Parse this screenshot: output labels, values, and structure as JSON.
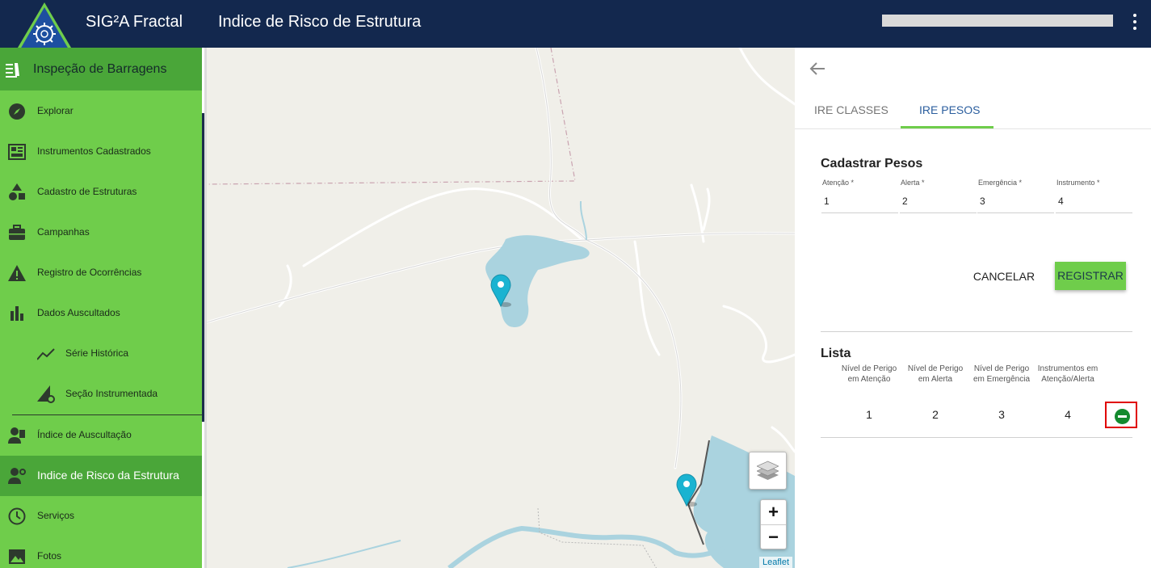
{
  "header": {
    "app_name": "SIG²A Fractal",
    "page_title": "Indice de Risco de Estrutura",
    "background_color": "#13284e"
  },
  "sidebar": {
    "section_title": "Inspeção de Barragens",
    "background_color": "#6fcd4b",
    "active_color": "#4aa639",
    "items": [
      {
        "label": "Explorar",
        "icon": "compass-icon"
      },
      {
        "label": "Instrumentos Cadastrados",
        "icon": "dashboard-icon"
      },
      {
        "label": "Cadastro de Estruturas",
        "icon": "shapes-icon"
      },
      {
        "label": "Campanhas",
        "icon": "briefcase-icon"
      },
      {
        "label": "Registro de Ocorrências",
        "icon": "warning-icon"
      },
      {
        "label": "Dados Auscultados",
        "icon": "bar-chart-icon"
      },
      {
        "label": "Série Histórica",
        "icon": "trend-line-icon"
      },
      {
        "label": "Seção Instrumentada",
        "icon": "section-gear-icon"
      },
      {
        "label": "Índice de Auscultação",
        "icon": "worker-icon"
      },
      {
        "label": "Indice de Risco da Estrutura",
        "icon": "worker-settings-icon",
        "active": true
      },
      {
        "label": "Serviços",
        "icon": "clock-icon"
      },
      {
        "label": "Fotos",
        "icon": "image-icon"
      }
    ]
  },
  "map": {
    "attribution": "Leaflet",
    "zoom_in": "+",
    "zoom_out": "−",
    "water_color": "#aad3df",
    "marker_color": "#1ab3d1"
  },
  "panel": {
    "tabs": [
      {
        "label": "IRE CLASSES",
        "active": false
      },
      {
        "label": "IRE PESOS",
        "active": true
      }
    ],
    "form": {
      "title": "Cadastrar Pesos",
      "fields": [
        {
          "label": "Atenção *",
          "value": "1"
        },
        {
          "label": "Alerta *",
          "value": "2"
        },
        {
          "label": "Emergência *",
          "value": "3"
        },
        {
          "label": "Instrumento *",
          "value": "4"
        }
      ],
      "cancel_label": "CANCELAR",
      "register_label": "REGISTRAR"
    },
    "list": {
      "title": "Lista",
      "columns": [
        "Nível de Perigo em Atenção",
        "Nível de Perigo em Alerta",
        "Nível de Perigo em Emergência",
        "Instrumentos em Atenção/Alerta"
      ],
      "rows": [
        {
          "values": [
            "1",
            "2",
            "3",
            "4"
          ],
          "action_icon": "remove-circle-icon"
        }
      ]
    }
  }
}
